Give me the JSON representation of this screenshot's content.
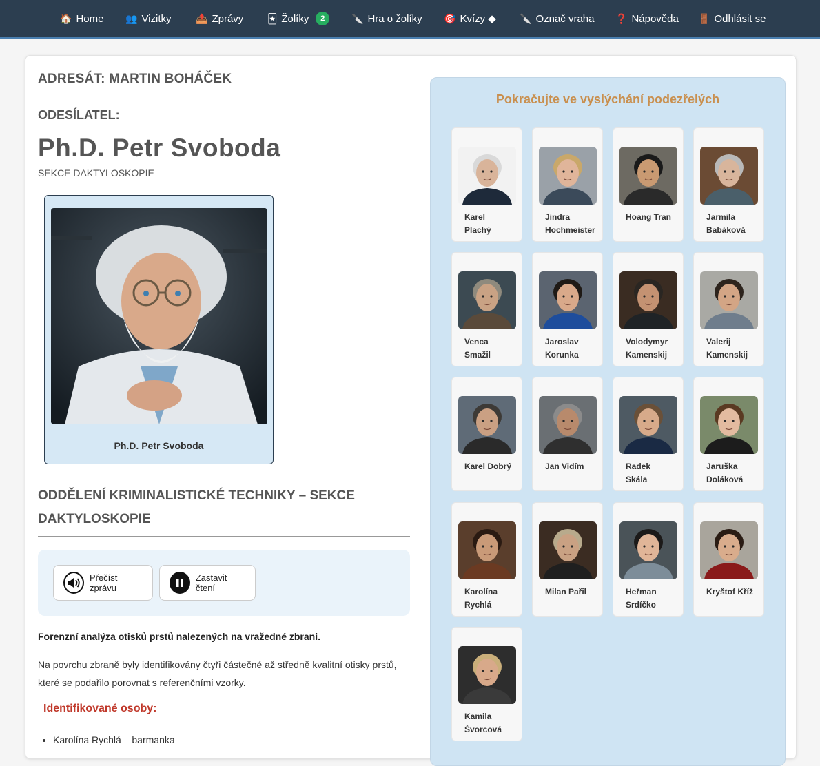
{
  "nav": [
    {
      "icon": "🏠",
      "label": "Home"
    },
    {
      "icon": "👥",
      "label": "Vizitky"
    },
    {
      "icon": "📤",
      "label": "Zprávy"
    },
    {
      "icon": "🃏",
      "label": "Žolíky",
      "badge": "2"
    },
    {
      "icon": "🔪",
      "label": "Hra o žolíky"
    },
    {
      "icon": "🎯",
      "label": "Kvízy ◆"
    },
    {
      "icon": "🔪",
      "label": "Označ vraha"
    },
    {
      "icon": "❓",
      "label": "Nápověda"
    },
    {
      "icon": "🚪",
      "label": "Odhlásit se"
    }
  ],
  "message": {
    "adresat": "ADRESÁT: MARTIN BOHÁČEK",
    "odesilatel_label": "ODESÍLATEL:",
    "sender_name": "Ph.D. Petr Svoboda",
    "sender_section": "SEKCE DAKTYLOSKOPIE",
    "photo_caption": "Ph.D. Petr Svoboda",
    "department": "ODDĚLENÍ KRIMINALISTICKÉ TECHNIKY – SEKCE DAKTYLOSKOPIE",
    "read_button": "Přečíst zprávu",
    "stop_button": "Zastavit čtení",
    "intro": "Forenzní analýza otisků prstů nalezených na vražedné zbrani.",
    "paragraph": "Na povrchu zbraně byly identifikovány čtyři částečné až středně kvalitní otisky prstů, které se podařilo porovnat s referenčními vzorky.",
    "identified_heading": "Identifikované osoby:",
    "identified": [
      "Karolína Rychlá – barmanka"
    ]
  },
  "suspects_panel": {
    "title": "Pokračujte ve vyslýchání podezřelých",
    "suspects": [
      {
        "first": "Karel",
        "last": "Plachý",
        "skin": "#d9b49a",
        "hair": "#d9d9d9",
        "bg": "#f2f2f2",
        "shirt": "#1e2a3a"
      },
      {
        "first": "Jindra",
        "last": "Hochmeister",
        "skin": "#e0b59a",
        "hair": "#c9a86a",
        "bg": "#9aa1a8",
        "shirt": "#3b4a5a"
      },
      {
        "first": "Hoang Tran",
        "last": "",
        "skin": "#c99a72",
        "hair": "#1a1a1a",
        "bg": "#6d6a62",
        "shirt": "#2a2a2a"
      },
      {
        "first": "Jarmila",
        "last": "Babáková",
        "skin": "#d8b59c",
        "hair": "#b9b9b9",
        "bg": "#6b4b34",
        "shirt": "#4a5f6a"
      },
      {
        "first": "Venca",
        "last": "Smažil",
        "skin": "#c9a284",
        "hair": "#8f8a7d",
        "bg": "#3c4a52",
        "shirt": "#5a4a3a"
      },
      {
        "first": "Jaroslav",
        "last": "Korunka",
        "skin": "#d9a98a",
        "hair": "#1f1a16",
        "bg": "#5b6470",
        "shirt": "#1e4d9c"
      },
      {
        "first": "Volodymyr",
        "last": "Kamenskij",
        "skin": "#c49272",
        "hair": "#2a2622",
        "bg": "#3a2c22",
        "shirt": "#1f2326"
      },
      {
        "first": "Valerij",
        "last": "Kamenskij",
        "skin": "#d3a585",
        "hair": "#2d241d",
        "bg": "#a9a9a4",
        "shirt": "#6f7d8c"
      },
      {
        "first": "Karel Dobrý",
        "last": "",
        "skin": "#caa083",
        "hair": "#3d3a36",
        "bg": "#5f6b77",
        "shirt": "#2a2a2a"
      },
      {
        "first": "Jan Vidím",
        "last": "",
        "skin": "#b88a6c",
        "hair": "#8b8b8b",
        "bg": "#6a6f73",
        "shirt": "#2f2f2f"
      },
      {
        "first": "Radek",
        "last": "Skála",
        "skin": "#d7aa8a",
        "hair": "#6a5038",
        "bg": "#4e5a63",
        "shirt": "#1a2a44"
      },
      {
        "first": "Jaruška",
        "last": "Doláková",
        "skin": "#e3bba0",
        "hair": "#5a3a22",
        "bg": "#7a8a6a",
        "shirt": "#1c1c1c"
      },
      {
        "first": "Karolína",
        "last": "Rychlá",
        "skin": "#c99a78",
        "hair": "#2a1a12",
        "bg": "#5a3e2c",
        "shirt": "#6b3a22"
      },
      {
        "first": "Milan Pařil",
        "last": "",
        "skin": "#c9a183",
        "hair": "#b8aa8c",
        "bg": "#3b2c22",
        "shirt": "#1f1f1f"
      },
      {
        "first": "Heřman",
        "last": "Srdíčko",
        "skin": "#e0b598",
        "hair": "#1c1a19",
        "bg": "#4a5358",
        "shirt": "#7d8d99"
      },
      {
        "first": "Kryštof Kříž",
        "last": "",
        "skin": "#d9ac8c",
        "hair": "#2a1c14",
        "bg": "#a9a59c",
        "shirt": "#8a1a1a"
      },
      {
        "first": "Kamila",
        "last": "Švorcová",
        "skin": "#d8a98a",
        "hair": "#c9ae7a",
        "bg": "#2d2d2d",
        "shirt": "#3a3a3a"
      }
    ]
  }
}
